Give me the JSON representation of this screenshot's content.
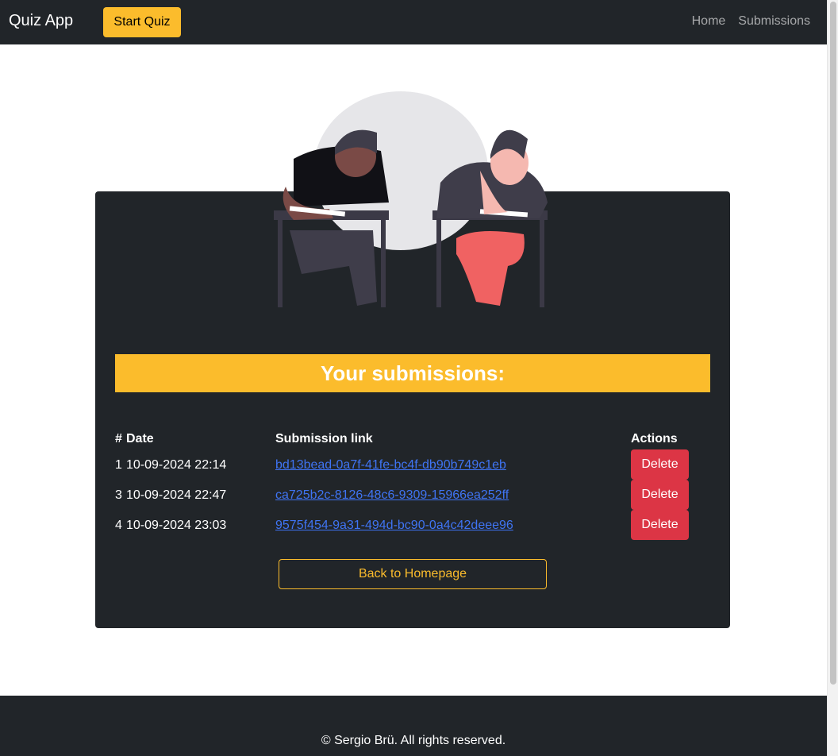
{
  "navbar": {
    "brand": "Quiz App",
    "start_label": "Start Quiz",
    "links": [
      "Home",
      "Submissions"
    ]
  },
  "banner": {
    "title": "Your submissions:"
  },
  "table": {
    "headers": {
      "num": "#",
      "date": "Date",
      "link": "Submission link",
      "actions": "Actions"
    },
    "rows": [
      {
        "num": "1",
        "date": "10-09-2024 22:14",
        "link": "bd13bead-0a7f-41fe-bc4f-db90b749c1eb",
        "action": "Delete"
      },
      {
        "num": "3",
        "date": "10-09-2024 22:47",
        "link": "ca725b2c-8126-48c6-9309-15966ea252ff",
        "action": "Delete"
      },
      {
        "num": "4",
        "date": "10-09-2024 23:03",
        "link": "9575f454-9a31-494d-bc90-0a4c42deee96",
        "action": "Delete"
      }
    ]
  },
  "back_label": "Back to Homepage",
  "footer": {
    "text": "© Sergio Brü. All rights reserved."
  },
  "colors": {
    "dark": "#212529",
    "accent": "#fbbc2c",
    "danger": "#dc3545",
    "link": "#3f74f3"
  },
  "illustration": "two-students-writing-illustration"
}
